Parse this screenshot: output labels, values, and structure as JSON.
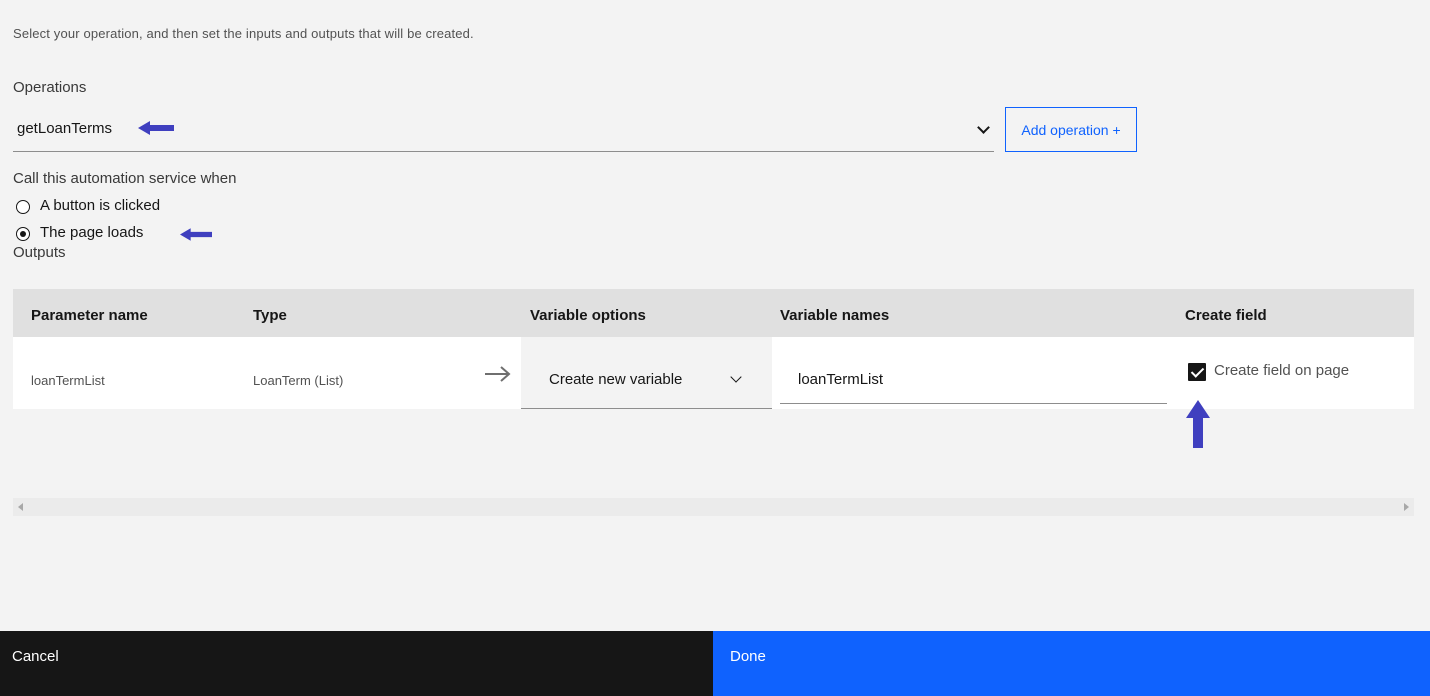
{
  "description": "Select your operation, and then set the inputs and outputs that will be created.",
  "operations": {
    "label": "Operations",
    "selected": "getLoanTerms",
    "add_button": "Add operation +"
  },
  "trigger": {
    "label": "Call this automation service when",
    "options": [
      {
        "label": "A button is clicked",
        "checked": false
      },
      {
        "label": "The page loads",
        "checked": true
      }
    ]
  },
  "outputs": {
    "label": "Outputs",
    "columns": [
      "Parameter name",
      "Type",
      "Variable options",
      "Variable names",
      "Create field"
    ],
    "rows": [
      {
        "parameter_name": "loanTermList",
        "type": "LoanTerm (List)",
        "variable_option": "Create new variable",
        "variable_name": "loanTermList",
        "create_field_label": "Create field on page",
        "create_field_checked": true
      }
    ]
  },
  "footer": {
    "cancel": "Cancel",
    "done": "Done"
  },
  "colors": {
    "primary": "#0f62fe",
    "annotation_arrow": "#3f3fbf",
    "cancel_bg": "#161616"
  },
  "icons": [
    "chevron-down-icon",
    "arrow-right-icon",
    "annotation-arrow-icon",
    "checkmark-icon"
  ]
}
